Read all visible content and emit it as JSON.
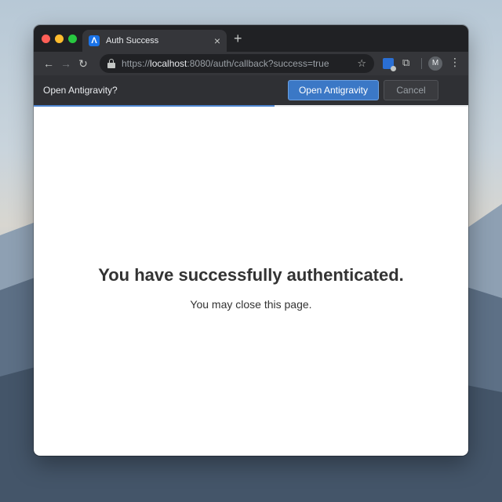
{
  "browser": {
    "tab": {
      "title": "Auth Success",
      "favicon_glyph": "Λ",
      "close_glyph": "×"
    },
    "new_tab_glyph": "+",
    "toolbar": {
      "back_glyph": "←",
      "forward_glyph": "→",
      "reload_glyph": "↻",
      "url_prefix": "https://",
      "url_host": "localhost",
      "url_rest": ":8080/auth/callback?success=true",
      "bookmark_glyph": "☆",
      "extensions_glyph": "⧉",
      "profile_initial": "M",
      "menu_glyph": "⋮"
    },
    "icons": {
      "back": "back-arrow-icon",
      "forward": "forward-arrow-icon",
      "reload": "reload-icon",
      "lock": "lock-icon",
      "bookmark": "star-icon",
      "password_ext": "key-extension-icon",
      "extensions": "puzzle-icon",
      "menu": "kebab-menu-icon"
    }
  },
  "prompt": {
    "text": "Open Antigravity?",
    "open_label": "Open Antigravity",
    "cancel_label": "Cancel",
    "load_progress": 0.555
  },
  "page": {
    "headline": "You have successfully authenticated.",
    "subtext": "You may close this page."
  },
  "colors": {
    "accent": "#3b78c6",
    "chrome_dark": "#202124",
    "toolbar": "#35363a"
  }
}
